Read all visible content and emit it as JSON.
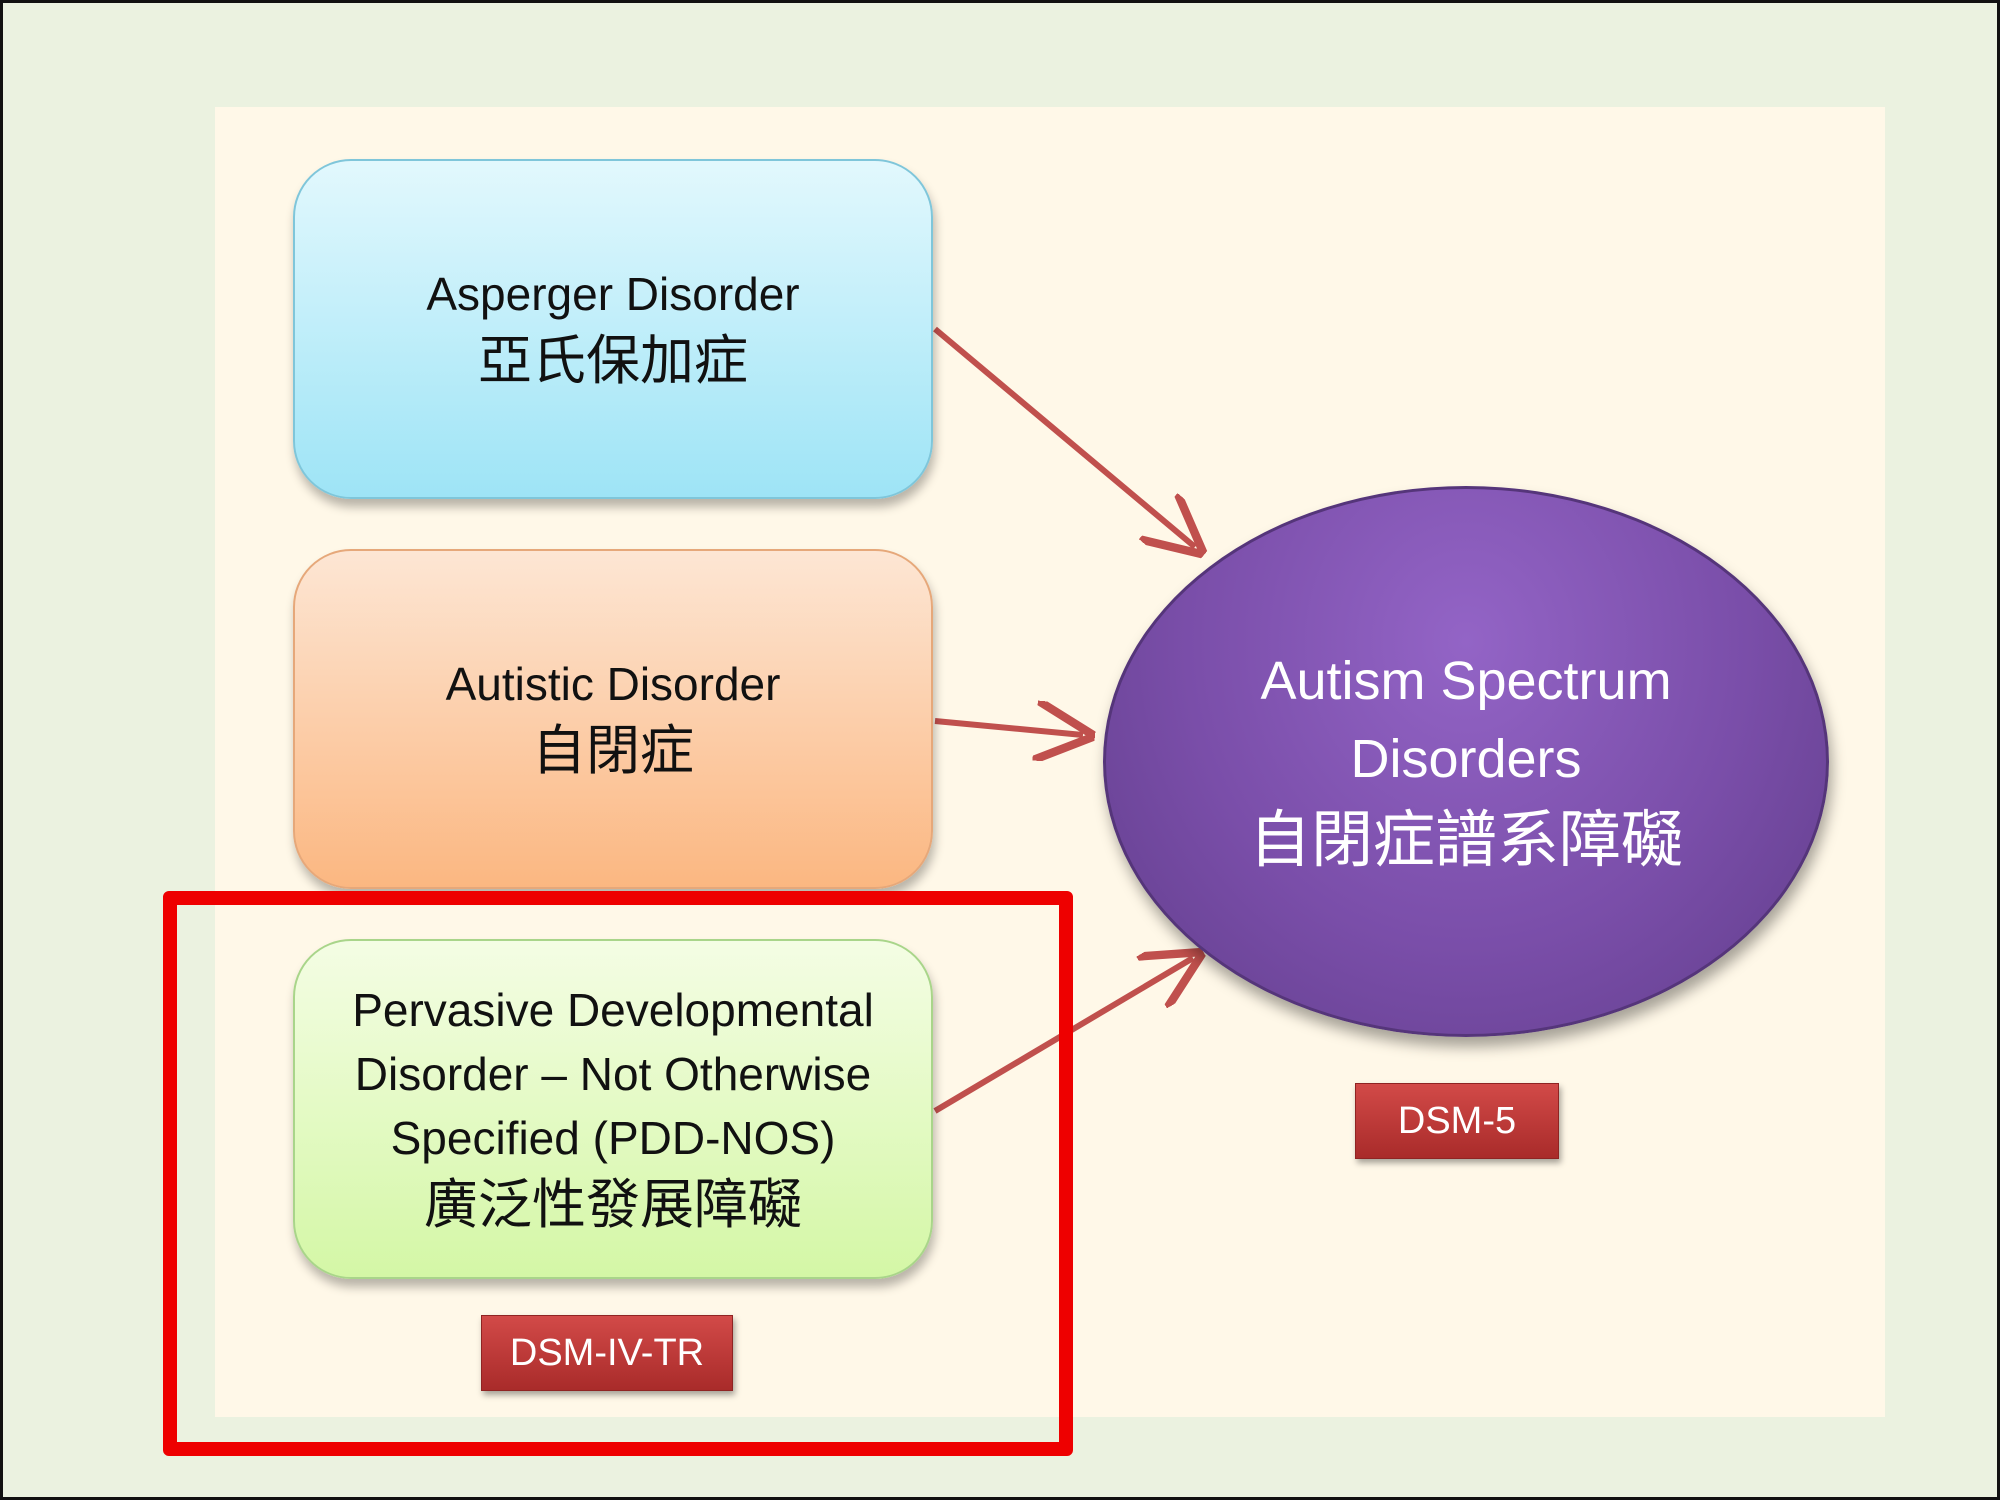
{
  "boxes": {
    "asperger": {
      "en": "Asperger Disorder",
      "zh": "亞氏保加症"
    },
    "autistic": {
      "en": "Autistic Disorder",
      "zh": "自閉症"
    },
    "pddnos": {
      "en_line1": "Pervasive Developmental",
      "en_line2": "Disorder – Not Otherwise",
      "en_line3": "Specified (PDD-NOS)",
      "zh": "廣泛性發展障礙"
    }
  },
  "target": {
    "en_line1": "Autism Spectrum",
    "en_line2": "Disorders",
    "zh": "自閉症譜系障礙"
  },
  "tags": {
    "dsm5": "DSM-5",
    "dsm_iv_tr": "DSM-IV-TR"
  },
  "colors": {
    "arrow": "#c0504d",
    "highlight": "#ee0000",
    "ellipse": "#7a4ea9"
  }
}
